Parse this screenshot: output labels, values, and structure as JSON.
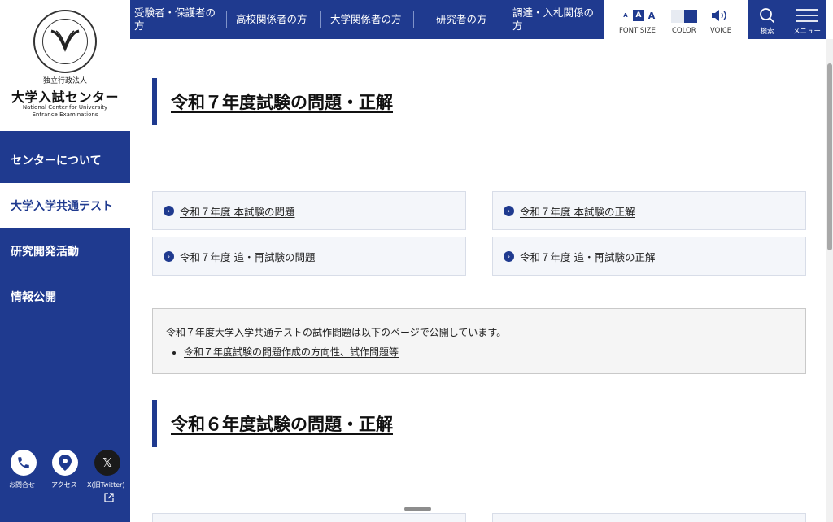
{
  "logo": {
    "seal_text": "NATIONAL CENTER FOR UNIVERSITY ENTRANCE EXAMINATIONS",
    "small": "独立行政法人",
    "main": "大学入試センター",
    "en_line1": "National Center for University",
    "en_line2": "Entrance Examinations"
  },
  "sidebar": {
    "items": [
      {
        "label": "センターについて"
      },
      {
        "label": "大学入学共通テスト"
      },
      {
        "label": "研究開発活動"
      },
      {
        "label": "情報公開"
      }
    ],
    "contact_label": "お問合せ",
    "access_label": "アクセス",
    "x_label": "X(旧Twitter)",
    "x_glyph": "𝕏"
  },
  "topnav": {
    "links": [
      {
        "label": "受験者・保護者の方"
      },
      {
        "label": "高校関係者の方"
      },
      {
        "label": "大学関係者の方"
      },
      {
        "label": "研究者の方"
      },
      {
        "label": "調達・入札関係の方"
      }
    ]
  },
  "tools": {
    "font_size_label": "FONT SIZE",
    "font_sizes": [
      "A",
      "A",
      "A"
    ],
    "color_label": "COLOR",
    "voice_label": "VOICE",
    "search_label": "検索",
    "menu_label": "メニュー"
  },
  "sections": [
    {
      "heading": "令和７年度試験の問題・正解",
      "links": [
        {
          "label": "令和７年度 本試験の問題"
        },
        {
          "label": "令和７年度 本試験の正解"
        },
        {
          "label": "令和７年度 追・再試験の問題"
        },
        {
          "label": "令和７年度 追・再試験の正解"
        }
      ],
      "notice": {
        "text": "令和７年度大学入学共通テストの試作問題は以下のページで公開しています。",
        "link": "令和７年度試験の問題作成の方向性、試作問題等"
      }
    },
    {
      "heading": "令和６年度試験の問題・正解"
    }
  ],
  "colors": {
    "brand": "#1f3a8f",
    "card_bg": "#f4f6fa"
  }
}
